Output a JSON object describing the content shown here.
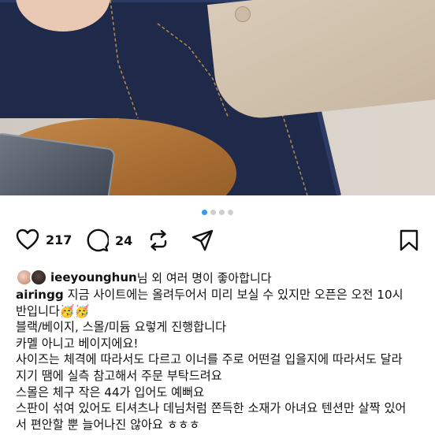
{
  "post": {
    "image_alt": "photo",
    "carousel": {
      "total": 4,
      "active": 0
    }
  },
  "actions": {
    "like_count": "217",
    "comment_count": "24",
    "icons": [
      "heart-icon",
      "comment-icon",
      "repost-icon",
      "share-icon",
      "bookmark-icon"
    ]
  },
  "liked_by": {
    "username": "ieeyounghun",
    "text": "님 외 여러 명이 좋아합니다"
  },
  "caption": {
    "author": "airingg",
    "lines": [
      " 지금 사이트에는 올려두어서 미리 보실 수 있지만 오픈은 오전 10시",
      "반입니다🥳🥳",
      "블랙/베이지, 스몰/미듐 요렇게 진행합니다",
      "카멜 아니고 베이지에요!",
      "사이즈는 체격에 따라서도 다르고 이너를 주로 어떤걸 입을지에 따라서도 달라",
      "지기 땜에 실측 참고해서 주문 부탁드려요",
      "스몰은 체구 작은 44가 입어도 예뻐요",
      "스판이 섞여 있어도 티셔츠나 데님처럼 쫀득한 소재가 아녀요 텐션만 살짝 있어",
      "서 편안할 뿐 늘어나진 않아요 ㅎㅎㅎ"
    ]
  },
  "colors": {
    "accent_dot": "#3897f0",
    "text": "#111111"
  }
}
